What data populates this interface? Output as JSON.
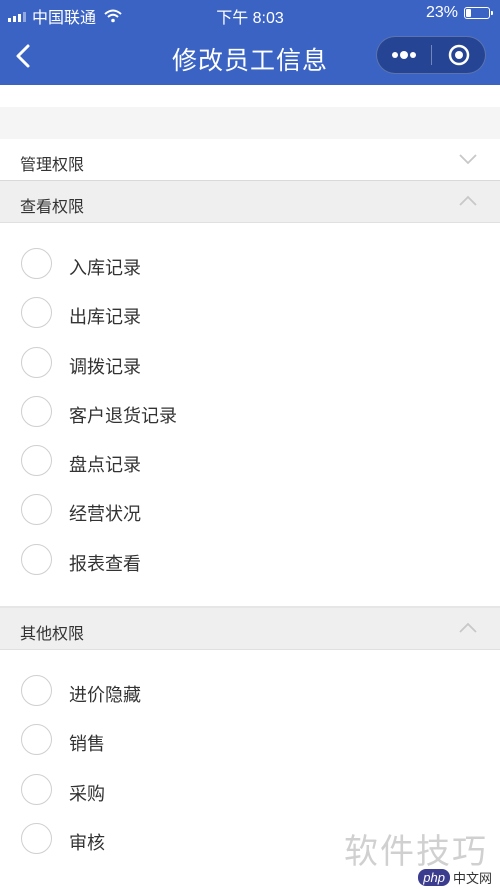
{
  "status_bar": {
    "carrier": "中国联通",
    "time": "下午 8:03",
    "battery": "23%",
    "battery_level": 0.23
  },
  "nav": {
    "title": "修改员工信息",
    "back_icon": "chevron-left-icon",
    "more_icon": "more-dots-icon",
    "close_icon": "target-close-icon"
  },
  "sections": {
    "manage": {
      "label": "管理权限",
      "expanded": false
    },
    "view": {
      "label": "查看权限",
      "expanded": true,
      "items": [
        "入库记录",
        "出库记录",
        "调拨记录",
        "客户退货记录",
        "盘点记录",
        "经营状况",
        "报表查看"
      ]
    },
    "other": {
      "label": "其他权限",
      "expanded": true,
      "items": [
        "进价隐藏",
        "销售",
        "采购",
        "审核"
      ]
    }
  },
  "watermark": {
    "text": "软件技巧",
    "logo_badge": "php",
    "logo_text": "中文网"
  },
  "colors": {
    "primary": "#3b63c4"
  }
}
